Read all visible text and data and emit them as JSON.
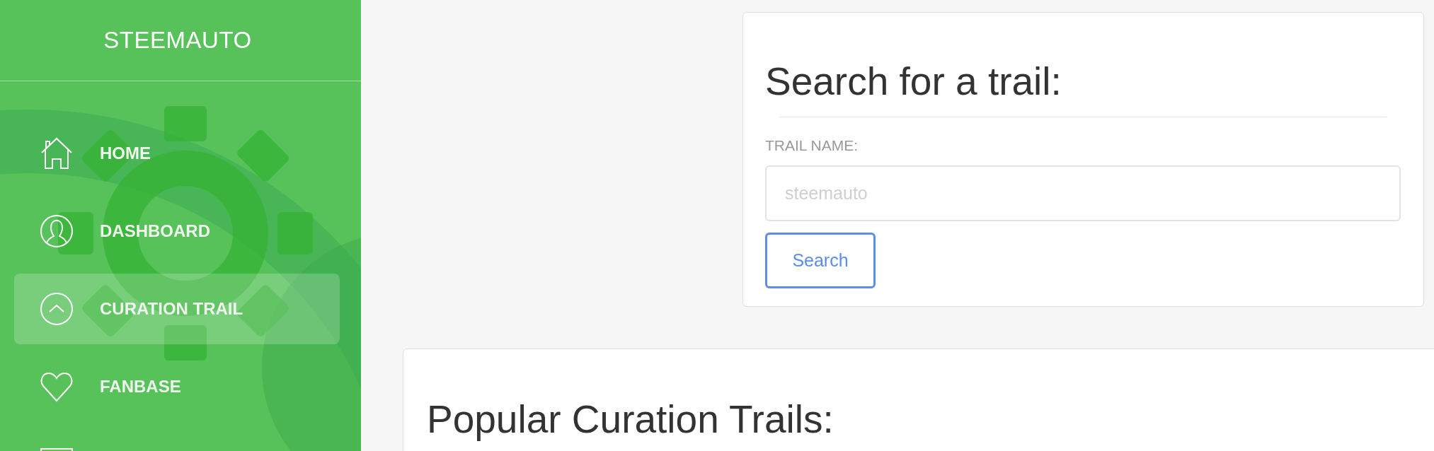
{
  "sidebar": {
    "title": "STEEMAUTO",
    "items": [
      {
        "kind": "home",
        "label": "HOME",
        "selected": false
      },
      {
        "kind": "user",
        "label": "DASHBOARD",
        "selected": false
      },
      {
        "kind": "chevron",
        "label": "CURATION TRAIL",
        "selected": true
      },
      {
        "kind": "heart",
        "label": "FANBASE",
        "selected": false
      },
      {
        "kind": "box",
        "selected": false
      }
    ]
  },
  "search_card": {
    "title": "Search for a trail:",
    "field_label": "TRAIL NAME:",
    "field": {
      "placeholder": "steemauto"
    },
    "button": "Search"
  },
  "trails_card": {
    "title": "Popular Curation Trails:"
  }
}
